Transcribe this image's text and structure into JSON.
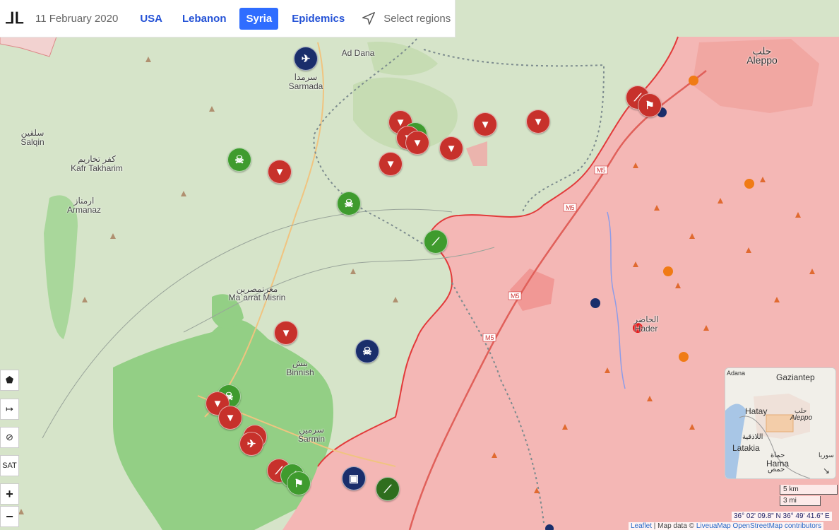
{
  "topbar": {
    "logo_icon": "liveuamap-logo-icon",
    "date": "11 February 2020",
    "tabs": [
      {
        "label": "USA",
        "active": false
      },
      {
        "label": "Lebanon",
        "active": false
      },
      {
        "label": "Syria",
        "active": true
      },
      {
        "label": "Epidemics",
        "active": false
      }
    ],
    "select_regions": "Select regions"
  },
  "colors": {
    "government_zone": "#f4b7b5",
    "opposition_zone": "#d6e4c9",
    "dense_green": "#93cf85",
    "front_line": "#e23a3a",
    "road": "#f0c480",
    "marker_red": "#c7312b",
    "marker_green": "#3f9b2e",
    "marker_navy": "#1a2e6b",
    "orange_dot": "#f07b15"
  },
  "places": [
    {
      "native": "",
      "name": "Ad Dana"
    },
    {
      "native": "سرمدا",
      "name": "Sarmada"
    },
    {
      "native": "سلقين",
      "name": "Salqin"
    },
    {
      "native": "كفر تخاريم",
      "name": "Kafr Takharim"
    },
    {
      "native": "ارمناز",
      "name": "Armanaz"
    },
    {
      "native": "معرتمصرين",
      "name": "Ma`arrat Misrin"
    },
    {
      "native": "بنش",
      "name": "Binnish"
    },
    {
      "native": "سرمين",
      "name": "Sarmin"
    },
    {
      "native": "حلب",
      "name": "Aleppo"
    },
    {
      "native": "الحاضر",
      "name": "Hader"
    }
  ],
  "road_labels": [
    "M5",
    "M5",
    "M5",
    "M5"
  ],
  "markers": [
    {
      "icon": "helicopter-icon",
      "color": "navy"
    },
    {
      "icon": "skull-icon",
      "color": "green"
    },
    {
      "icon": "bomb-icon",
      "color": "red"
    },
    {
      "icon": "skull-icon",
      "color": "green"
    },
    {
      "icon": "bomb-icon",
      "color": "red"
    },
    {
      "icon": "bomb-icon",
      "color": "red"
    },
    {
      "icon": "bomb-icon",
      "color": "red"
    },
    {
      "icon": "bomb-icon",
      "color": "red"
    },
    {
      "icon": "bomb-icon",
      "color": "red"
    },
    {
      "icon": "bomb-icon",
      "color": "red"
    },
    {
      "icon": "bomb-icon",
      "color": "red"
    },
    {
      "icon": "rifle-icon",
      "color": "green"
    },
    {
      "icon": "rifle-icon",
      "color": "red"
    },
    {
      "icon": "flag-icon",
      "color": "red"
    },
    {
      "icon": "bomb-icon",
      "color": "red"
    },
    {
      "icon": "skull-icon",
      "color": "navy"
    },
    {
      "icon": "skull-icon",
      "color": "green"
    },
    {
      "icon": "bomb-icon",
      "color": "red"
    },
    {
      "icon": "bomb-icon",
      "color": "red"
    },
    {
      "icon": "helicopter-icon",
      "color": "red"
    },
    {
      "icon": "helicopter-icon",
      "color": "red"
    },
    {
      "icon": "rifle-icon",
      "color": "red"
    },
    {
      "icon": "flag-icon",
      "color": "green"
    },
    {
      "icon": "photo-icon",
      "color": "navy"
    },
    {
      "icon": "rifle-icon",
      "color": "dgreen"
    }
  ],
  "controls": {
    "polygon_tool": "polygon-tool-icon",
    "route_tool": "arrow-right-icon",
    "hide_tool": "eye-off-icon",
    "sat_label": "SAT",
    "zoom_in": "+",
    "zoom_out": "−"
  },
  "minimap": {
    "labels": [
      "Adana",
      "Gaziantep",
      "Hatay",
      "حلب",
      "Aleppo",
      "اللاذقية",
      "Latakia",
      "حماة",
      "Hama",
      "حمص",
      "سوريا"
    ]
  },
  "scale": {
    "km": "5 km",
    "mi": "3 mi"
  },
  "coords": "36° 02' 09.8\" N 36° 49' 41.6\" E",
  "attribution": {
    "leaflet": "Leaflet",
    "sep": " | Map data © ",
    "providers": "LiveuaMap OpenStreetMap contributors"
  }
}
